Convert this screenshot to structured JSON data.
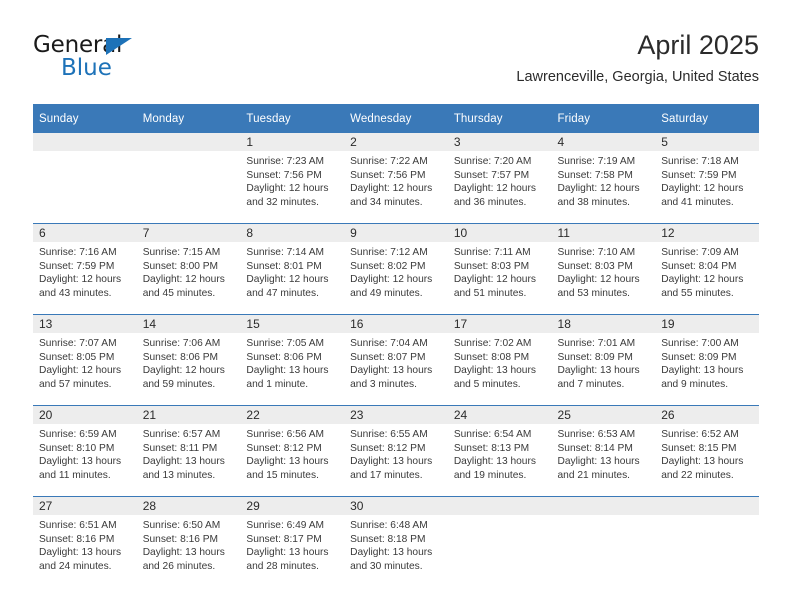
{
  "brand": {
    "name_top": "General",
    "name_bottom": "Blue",
    "triangle_color": "#1d72b8"
  },
  "header": {
    "title": "April 2025",
    "subtitle": "Lawrenceville, Georgia, United States"
  },
  "theme": {
    "header_blue": "#3a79b8",
    "daynum_band": "#ededed",
    "text": "#2b2b2b"
  },
  "calendar": {
    "weekday_headers": [
      "Sunday",
      "Monday",
      "Tuesday",
      "Wednesday",
      "Thursday",
      "Friday",
      "Saturday"
    ],
    "weeks": [
      [
        {
          "day": ""
        },
        {
          "day": ""
        },
        {
          "day": "1",
          "sunrise": "Sunrise: 7:23 AM",
          "sunset": "Sunset: 7:56 PM",
          "daylight": "Daylight: 12 hours and 32 minutes."
        },
        {
          "day": "2",
          "sunrise": "Sunrise: 7:22 AM",
          "sunset": "Sunset: 7:56 PM",
          "daylight": "Daylight: 12 hours and 34 minutes."
        },
        {
          "day": "3",
          "sunrise": "Sunrise: 7:20 AM",
          "sunset": "Sunset: 7:57 PM",
          "daylight": "Daylight: 12 hours and 36 minutes."
        },
        {
          "day": "4",
          "sunrise": "Sunrise: 7:19 AM",
          "sunset": "Sunset: 7:58 PM",
          "daylight": "Daylight: 12 hours and 38 minutes."
        },
        {
          "day": "5",
          "sunrise": "Sunrise: 7:18 AM",
          "sunset": "Sunset: 7:59 PM",
          "daylight": "Daylight: 12 hours and 41 minutes."
        }
      ],
      [
        {
          "day": "6",
          "sunrise": "Sunrise: 7:16 AM",
          "sunset": "Sunset: 7:59 PM",
          "daylight": "Daylight: 12 hours and 43 minutes."
        },
        {
          "day": "7",
          "sunrise": "Sunrise: 7:15 AM",
          "sunset": "Sunset: 8:00 PM",
          "daylight": "Daylight: 12 hours and 45 minutes."
        },
        {
          "day": "8",
          "sunrise": "Sunrise: 7:14 AM",
          "sunset": "Sunset: 8:01 PM",
          "daylight": "Daylight: 12 hours and 47 minutes."
        },
        {
          "day": "9",
          "sunrise": "Sunrise: 7:12 AM",
          "sunset": "Sunset: 8:02 PM",
          "daylight": "Daylight: 12 hours and 49 minutes."
        },
        {
          "day": "10",
          "sunrise": "Sunrise: 7:11 AM",
          "sunset": "Sunset: 8:03 PM",
          "daylight": "Daylight: 12 hours and 51 minutes."
        },
        {
          "day": "11",
          "sunrise": "Sunrise: 7:10 AM",
          "sunset": "Sunset: 8:03 PM",
          "daylight": "Daylight: 12 hours and 53 minutes."
        },
        {
          "day": "12",
          "sunrise": "Sunrise: 7:09 AM",
          "sunset": "Sunset: 8:04 PM",
          "daylight": "Daylight: 12 hours and 55 minutes."
        }
      ],
      [
        {
          "day": "13",
          "sunrise": "Sunrise: 7:07 AM",
          "sunset": "Sunset: 8:05 PM",
          "daylight": "Daylight: 12 hours and 57 minutes."
        },
        {
          "day": "14",
          "sunrise": "Sunrise: 7:06 AM",
          "sunset": "Sunset: 8:06 PM",
          "daylight": "Daylight: 12 hours and 59 minutes."
        },
        {
          "day": "15",
          "sunrise": "Sunrise: 7:05 AM",
          "sunset": "Sunset: 8:06 PM",
          "daylight": "Daylight: 13 hours and 1 minute."
        },
        {
          "day": "16",
          "sunrise": "Sunrise: 7:04 AM",
          "sunset": "Sunset: 8:07 PM",
          "daylight": "Daylight: 13 hours and 3 minutes."
        },
        {
          "day": "17",
          "sunrise": "Sunrise: 7:02 AM",
          "sunset": "Sunset: 8:08 PM",
          "daylight": "Daylight: 13 hours and 5 minutes."
        },
        {
          "day": "18",
          "sunrise": "Sunrise: 7:01 AM",
          "sunset": "Sunset: 8:09 PM",
          "daylight": "Daylight: 13 hours and 7 minutes."
        },
        {
          "day": "19",
          "sunrise": "Sunrise: 7:00 AM",
          "sunset": "Sunset: 8:09 PM",
          "daylight": "Daylight: 13 hours and 9 minutes."
        }
      ],
      [
        {
          "day": "20",
          "sunrise": "Sunrise: 6:59 AM",
          "sunset": "Sunset: 8:10 PM",
          "daylight": "Daylight: 13 hours and 11 minutes."
        },
        {
          "day": "21",
          "sunrise": "Sunrise: 6:57 AM",
          "sunset": "Sunset: 8:11 PM",
          "daylight": "Daylight: 13 hours and 13 minutes."
        },
        {
          "day": "22",
          "sunrise": "Sunrise: 6:56 AM",
          "sunset": "Sunset: 8:12 PM",
          "daylight": "Daylight: 13 hours and 15 minutes."
        },
        {
          "day": "23",
          "sunrise": "Sunrise: 6:55 AM",
          "sunset": "Sunset: 8:12 PM",
          "daylight": "Daylight: 13 hours and 17 minutes."
        },
        {
          "day": "24",
          "sunrise": "Sunrise: 6:54 AM",
          "sunset": "Sunset: 8:13 PM",
          "daylight": "Daylight: 13 hours and 19 minutes."
        },
        {
          "day": "25",
          "sunrise": "Sunrise: 6:53 AM",
          "sunset": "Sunset: 8:14 PM",
          "daylight": "Daylight: 13 hours and 21 minutes."
        },
        {
          "day": "26",
          "sunrise": "Sunrise: 6:52 AM",
          "sunset": "Sunset: 8:15 PM",
          "daylight": "Daylight: 13 hours and 22 minutes."
        }
      ],
      [
        {
          "day": "27",
          "sunrise": "Sunrise: 6:51 AM",
          "sunset": "Sunset: 8:16 PM",
          "daylight": "Daylight: 13 hours and 24 minutes."
        },
        {
          "day": "28",
          "sunrise": "Sunrise: 6:50 AM",
          "sunset": "Sunset: 8:16 PM",
          "daylight": "Daylight: 13 hours and 26 minutes."
        },
        {
          "day": "29",
          "sunrise": "Sunrise: 6:49 AM",
          "sunset": "Sunset: 8:17 PM",
          "daylight": "Daylight: 13 hours and 28 minutes."
        },
        {
          "day": "30",
          "sunrise": "Sunrise: 6:48 AM",
          "sunset": "Sunset: 8:18 PM",
          "daylight": "Daylight: 13 hours and 30 minutes."
        },
        {
          "day": ""
        },
        {
          "day": ""
        },
        {
          "day": ""
        }
      ]
    ]
  }
}
